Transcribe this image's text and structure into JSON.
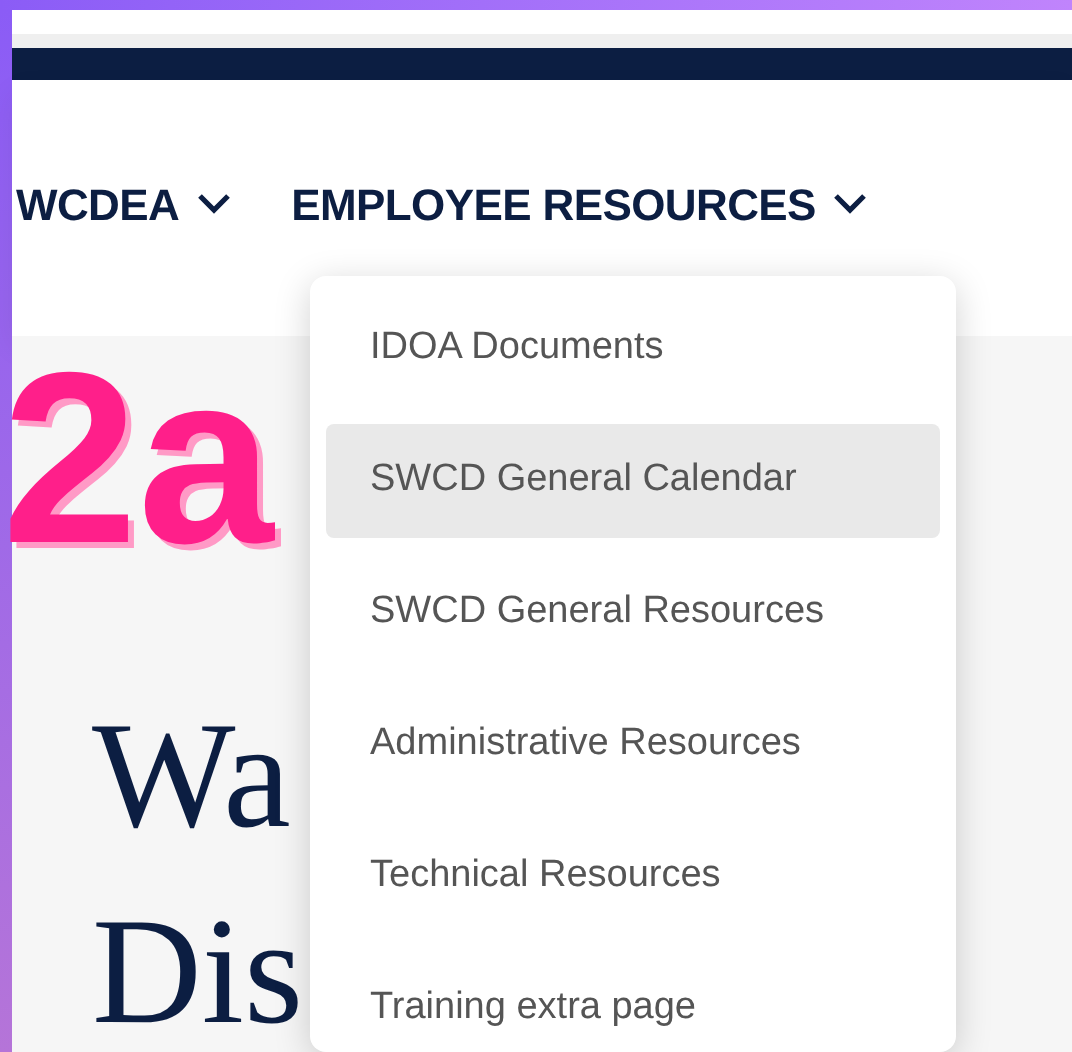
{
  "nav": [
    {
      "label": "WCDEA",
      "has_menu": true
    },
    {
      "label": "EMPLOYEE RESOURCES",
      "has_menu": true
    }
  ],
  "dropdown": {
    "items": [
      {
        "label": "IDOA Documents",
        "selected": false
      },
      {
        "label": "SWCD General Calendar",
        "selected": true
      },
      {
        "label": "SWCD General Resources",
        "selected": false
      },
      {
        "label": "Administrative Resources",
        "selected": false
      },
      {
        "label": "Technical Resources",
        "selected": false
      },
      {
        "label": "Training extra page",
        "selected": false
      }
    ]
  },
  "heading_lines": [
    "Wa",
    "Dis"
  ],
  "annotation": {
    "label": "2a"
  }
}
